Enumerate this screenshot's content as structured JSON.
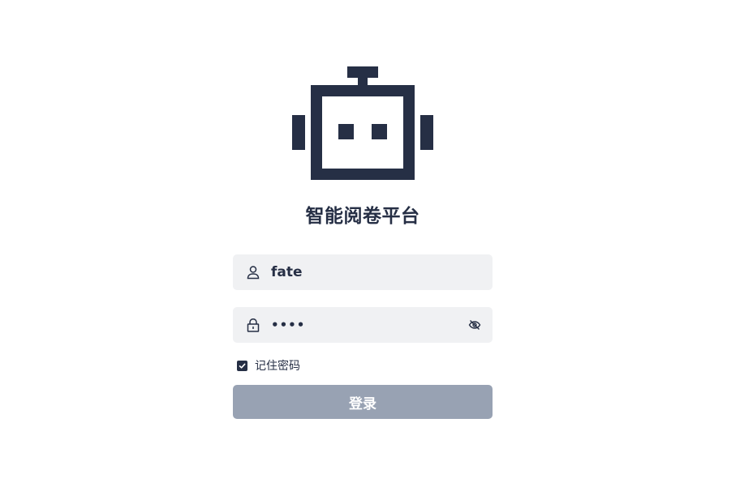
{
  "app": {
    "title": "智能阅卷平台",
    "logo_icon": "robot-icon"
  },
  "login_form": {
    "username": {
      "icon": "user-icon",
      "value": "fate"
    },
    "password": {
      "icon": "lock-icon",
      "value": "••••",
      "toggle_icon": "eye-off-icon"
    },
    "remember": {
      "label": "记住密码",
      "checked": true
    },
    "submit_label": "登录"
  },
  "colors": {
    "primary_dark": "#262f45",
    "field_bg": "#f0f1f3",
    "button_bg": "#98a2b3",
    "background": "#ffffff"
  }
}
